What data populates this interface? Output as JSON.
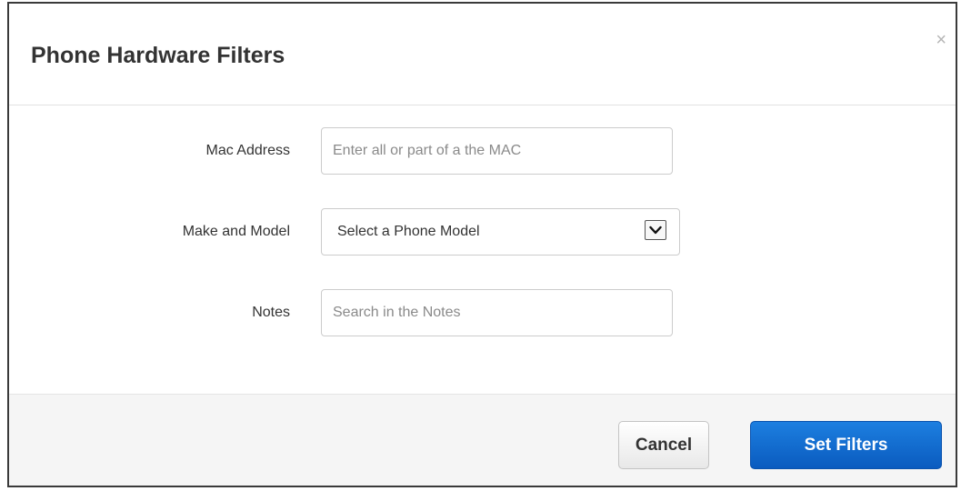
{
  "dialog": {
    "title": "Phone Hardware Filters",
    "close_symbol": "×"
  },
  "form": {
    "mac": {
      "label": "Mac Address",
      "placeholder": "Enter all or part of a the MAC",
      "value": ""
    },
    "model": {
      "label": "Make and Model",
      "selected": "Select a Phone Model"
    },
    "notes": {
      "label": "Notes",
      "placeholder": "Search in the Notes",
      "value": ""
    }
  },
  "footer": {
    "cancel_label": "Cancel",
    "submit_label": "Set Filters"
  },
  "colors": {
    "primary": "#0a63c9",
    "title_text": "#333333"
  }
}
